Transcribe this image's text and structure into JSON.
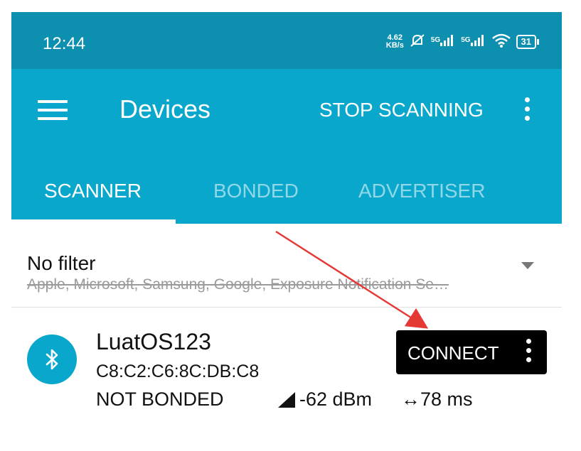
{
  "status_bar": {
    "time": "12:44",
    "net_speed_value": "4.62",
    "net_speed_unit": "KB/s",
    "sim1": "5G",
    "sim2": "5G",
    "battery": "31"
  },
  "app_bar": {
    "title": "Devices",
    "stop_scanning_label": "STOP SCANNING"
  },
  "tabs": [
    {
      "label": "SCANNER",
      "active": true
    },
    {
      "label": "BONDED",
      "active": false
    },
    {
      "label": "ADVERTISER",
      "active": false
    }
  ],
  "filter": {
    "title": "No filter",
    "subtitle": "Apple, Microsoft, Samsung, Google, Exposure Notification Se…"
  },
  "device": {
    "name": "LuatOS123",
    "address": "C8:C2:C6:8C:DB:C8",
    "bond_state": "NOT BONDED",
    "rssi": "-62 dBm",
    "interval": "↔78 ms",
    "connect_label": "CONNECT"
  },
  "colors": {
    "status_bar": "#0d8fb0",
    "app_bar": "#0aa7cc",
    "connect_button": "#000000",
    "annotation_arrow": "#e53935"
  }
}
